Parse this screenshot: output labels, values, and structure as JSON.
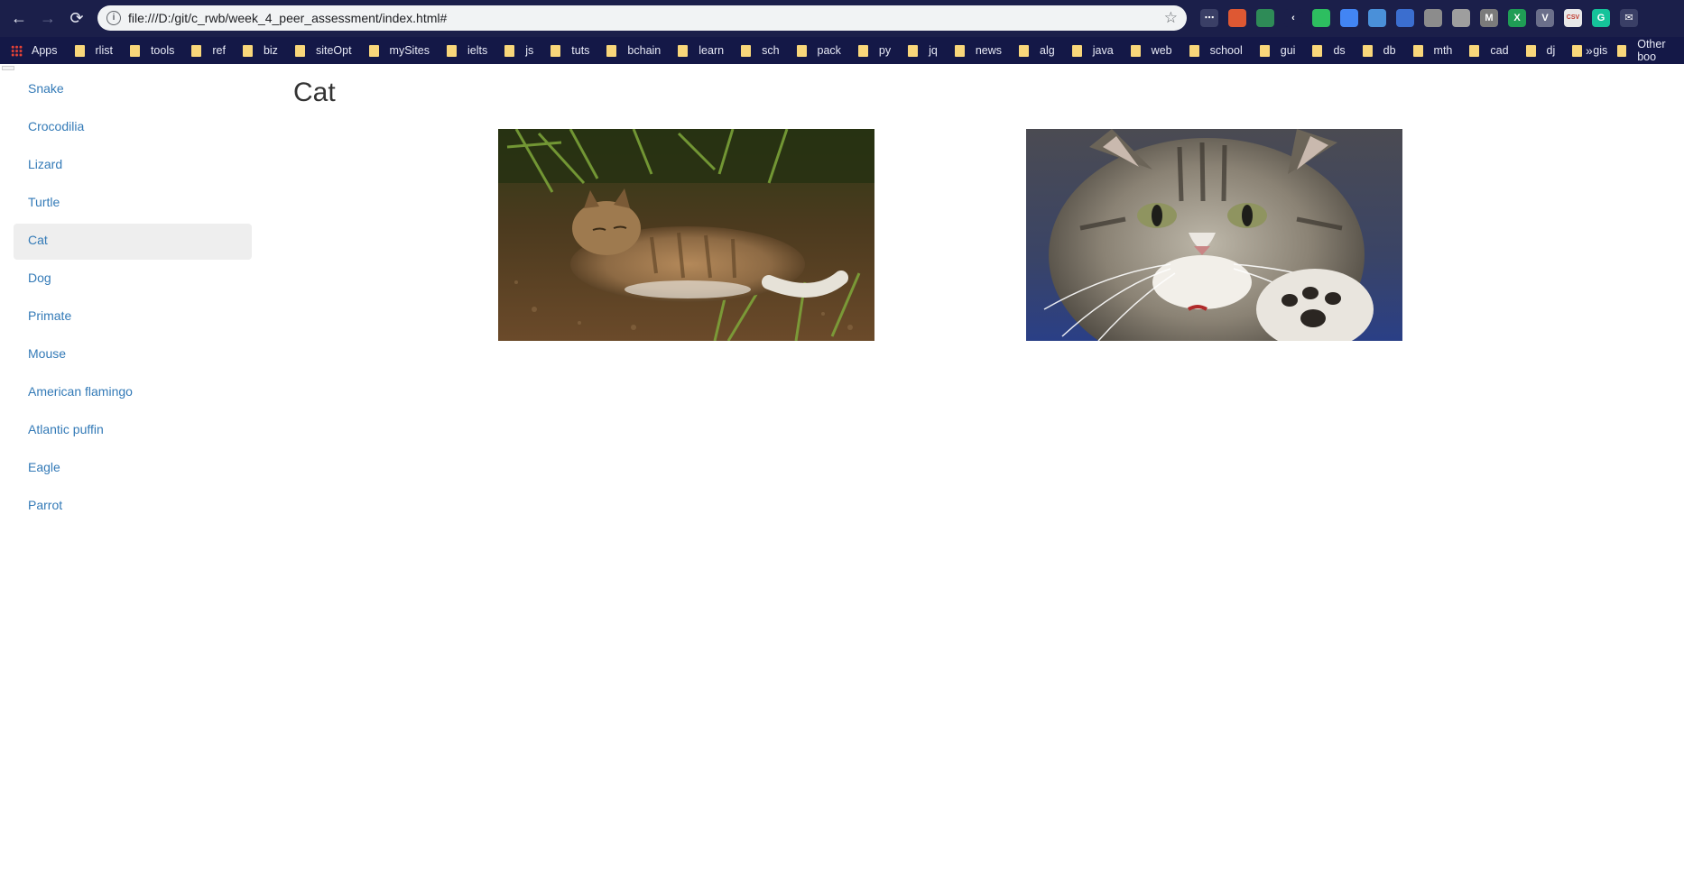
{
  "browser": {
    "url": "file:///D:/git/c_rwb/week_4_peer_assessment/index.html#",
    "nav": {
      "back": "←",
      "forward": "→",
      "reload": "⟳"
    },
    "star": "☆",
    "extensions": [
      {
        "name": "ext-dots",
        "glyph": "⋯",
        "color": "#3a3f66"
      },
      {
        "name": "ext-duckduckgo",
        "glyph": "",
        "color": "#de5833"
      },
      {
        "name": "ext-print",
        "glyph": "",
        "color": "#2e8b57"
      },
      {
        "name": "ext-back",
        "glyph": "‹",
        "color": "#1b1f4a"
      },
      {
        "name": "ext-evernote",
        "glyph": "",
        "color": "#2dbe60"
      },
      {
        "name": "ext-calendar",
        "glyph": "",
        "color": "#4285f4"
      },
      {
        "name": "ext-docs",
        "glyph": "",
        "color": "#4a90d9"
      },
      {
        "name": "ext-screen",
        "glyph": "",
        "color": "#3b6ecf"
      },
      {
        "name": "ext-location",
        "glyph": "",
        "color": "#8c8c8c"
      },
      {
        "name": "ext-circle",
        "glyph": "",
        "color": "#9e9e9e"
      },
      {
        "name": "ext-m",
        "glyph": "M",
        "color": "#7b7b7b"
      },
      {
        "name": "ext-excel",
        "glyph": "X",
        "color": "#1f9d55"
      },
      {
        "name": "ext-vue",
        "glyph": "V",
        "color": "#6b6f8a"
      },
      {
        "name": "ext-csv",
        "glyph": "CSV",
        "color": "#e8e8e8"
      },
      {
        "name": "ext-grammarly",
        "glyph": "G",
        "color": "#15c39a"
      },
      {
        "name": "ext-mail",
        "glyph": "✉",
        "color": "#3a3f66"
      }
    ]
  },
  "bookmarks": {
    "apps_label": "Apps",
    "items": [
      "rlist",
      "tools",
      "ref",
      "biz",
      "siteOpt",
      "mySites",
      "ielts",
      "js",
      "tuts",
      "bchain",
      "learn",
      "sch",
      "pack",
      "py",
      "jq",
      "news",
      "alg",
      "java",
      "web",
      "school",
      "gui",
      "ds",
      "db",
      "mth",
      "cad",
      "dj",
      "gis"
    ],
    "more_label": "»",
    "other_label": "Other boo"
  },
  "sidebar": {
    "items": [
      "Snake",
      "Crocodilia",
      "Lizard",
      "Turtle",
      "Cat",
      "Dog",
      "Primate",
      "Mouse",
      "American flamingo",
      "Atlantic puffin",
      "Eagle",
      "Parrot"
    ],
    "active": "Cat"
  },
  "main": {
    "title": "Cat"
  }
}
